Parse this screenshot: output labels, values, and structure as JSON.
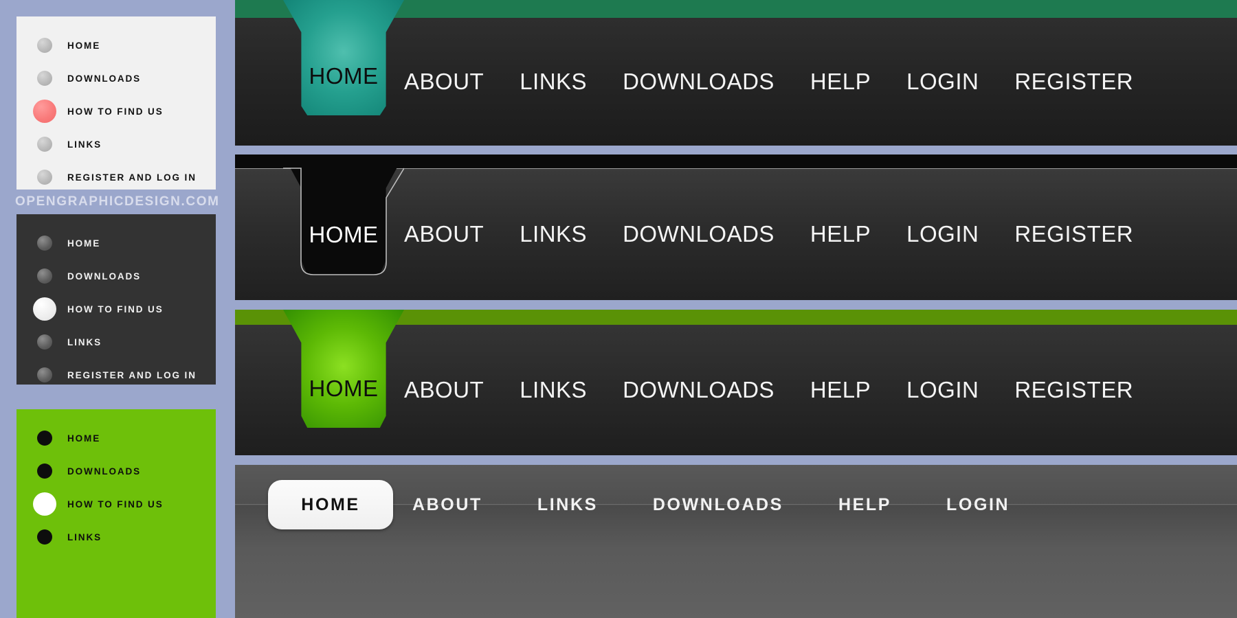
{
  "page": {
    "background_color": "#9ba7cc",
    "watermark": "OPENGRAPHICDESIGN.COM"
  },
  "vertical_menus": [
    {
      "theme": "light",
      "background_color": "#f1f1f1",
      "text_color": "#111111",
      "active_bullet_color": "#f97b7b",
      "items": [
        {
          "label": "HOME",
          "bullet": "dot-icon",
          "active": false
        },
        {
          "label": "DOWNLOADS",
          "bullet": "dot-icon",
          "active": false
        },
        {
          "label": "HOW TO FIND US",
          "bullet": "dot-icon",
          "active": true
        },
        {
          "label": "LINKS",
          "bullet": "dot-icon",
          "active": false
        },
        {
          "label": "REGISTER AND LOG IN",
          "bullet": "dot-icon",
          "active": false
        }
      ]
    },
    {
      "theme": "dark",
      "background_color": "#333333",
      "text_color": "#f2f2f2",
      "active_bullet_color": "#ededed",
      "items": [
        {
          "label": "HOME",
          "bullet": "dot-icon",
          "active": false
        },
        {
          "label": "DOWNLOADS",
          "bullet": "dot-icon",
          "active": false
        },
        {
          "label": "HOW TO FIND US",
          "bullet": "dot-icon",
          "active": true
        },
        {
          "label": "LINKS",
          "bullet": "dot-icon",
          "active": false
        },
        {
          "label": "REGISTER AND LOG IN",
          "bullet": "dot-icon",
          "active": false
        }
      ]
    },
    {
      "theme": "green",
      "background_color": "#6ec00a",
      "text_color": "#0d0d0d",
      "active_bullet_color": "#ffffff",
      "items": [
        {
          "label": "HOME",
          "bullet": "dot-icon",
          "active": false
        },
        {
          "label": "DOWNLOADS",
          "bullet": "dot-icon",
          "active": false
        },
        {
          "label": "HOW TO FIND US",
          "bullet": "dot-icon",
          "active": true
        },
        {
          "label": "LINKS",
          "bullet": "dot-icon",
          "active": false
        }
      ]
    }
  ],
  "navbars": [
    {
      "theme": "teal",
      "strip_color": "#1e7a50",
      "bar_color": "#262626",
      "tab_color": "#25a08f",
      "active_tab": "HOME",
      "links": [
        "ABOUT",
        "LINKS",
        "DOWNLOADS",
        "HELP",
        "LOGIN",
        "REGISTER"
      ]
    },
    {
      "theme": "black",
      "strip_color": "#0a0a0a",
      "bar_color": "#2c2c2c",
      "tab_color": "#0a0a0a",
      "active_tab": "HOME",
      "links": [
        "ABOUT",
        "LINKS",
        "DOWNLOADS",
        "HELP",
        "LOGIN",
        "REGISTER"
      ]
    },
    {
      "theme": "green",
      "strip_color": "#5a9206",
      "bar_color": "#2a2a2a",
      "tab_color": "#5db905",
      "active_tab": "HOME",
      "links": [
        "ABOUT",
        "LINKS",
        "DOWNLOADS",
        "HELP",
        "LOGIN",
        "REGISTER"
      ]
    },
    {
      "theme": "gray-pill",
      "bar_color": "#555555",
      "tab_color": "#f5f5f5",
      "active_tab": "HOME",
      "links": [
        "ABOUT",
        "LINKS",
        "DOWNLOADS",
        "HELP",
        "LOGIN"
      ]
    }
  ]
}
